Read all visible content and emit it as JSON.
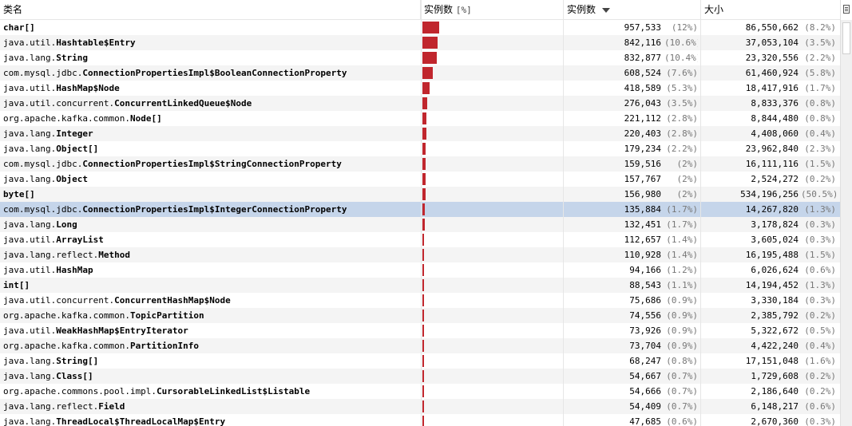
{
  "header": {
    "col_name": "类名",
    "col_bar": "实例数",
    "col_bar_sub": "[%]",
    "col_count": "实例数",
    "col_size": "大小"
  },
  "colors": {
    "bar": "#c0262d",
    "selected_row": "#c5d5ea"
  },
  "rows": [
    {
      "pkg": "",
      "cls": "char[]",
      "count": "957,533",
      "cpct": "(12%)",
      "size": "86,550,662",
      "spct": "(8.2%)",
      "bar_pct": 12.0
    },
    {
      "pkg": "java.util.",
      "cls": "Hashtable$Entry",
      "count": "842,116",
      "cpct": "(10.6%)",
      "size": "37,053,104",
      "spct": "(3.5%)",
      "bar_pct": 10.6
    },
    {
      "pkg": "java.lang.",
      "cls": "String",
      "count": "832,877",
      "cpct": "(10.4%)",
      "size": "23,320,556",
      "spct": "(2.2%)",
      "bar_pct": 10.4
    },
    {
      "pkg": "com.mysql.jdbc.",
      "cls": "ConnectionPropertiesImpl$BooleanConnectionProperty",
      "count": "608,524",
      "cpct": "(7.6%)",
      "size": "61,460,924",
      "spct": "(5.8%)",
      "bar_pct": 7.6
    },
    {
      "pkg": "java.util.",
      "cls": "HashMap$Node",
      "count": "418,589",
      "cpct": "(5.3%)",
      "size": "18,417,916",
      "spct": "(1.7%)",
      "bar_pct": 5.3
    },
    {
      "pkg": "java.util.concurrent.",
      "cls": "ConcurrentLinkedQueue$Node",
      "count": "276,043",
      "cpct": "(3.5%)",
      "size": "8,833,376",
      "spct": "(0.8%)",
      "bar_pct": 3.5
    },
    {
      "pkg": "org.apache.kafka.common.",
      "cls": "Node[]",
      "count": "221,112",
      "cpct": "(2.8%)",
      "size": "8,844,480",
      "spct": "(0.8%)",
      "bar_pct": 2.8
    },
    {
      "pkg": "java.lang.",
      "cls": "Integer",
      "count": "220,403",
      "cpct": "(2.8%)",
      "size": "4,408,060",
      "spct": "(0.4%)",
      "bar_pct": 2.8
    },
    {
      "pkg": "java.lang.",
      "cls": "Object[]",
      "count": "179,234",
      "cpct": "(2.2%)",
      "size": "23,962,840",
      "spct": "(2.3%)",
      "bar_pct": 2.2
    },
    {
      "pkg": "com.mysql.jdbc.",
      "cls": "ConnectionPropertiesImpl$StringConnectionProperty",
      "count": "159,516",
      "cpct": "(2%)",
      "size": "16,111,116",
      "spct": "(1.5%)",
      "bar_pct": 2.0
    },
    {
      "pkg": "java.lang.",
      "cls": "Object",
      "count": "157,767",
      "cpct": "(2%)",
      "size": "2,524,272",
      "spct": "(0.2%)",
      "bar_pct": 2.0
    },
    {
      "pkg": "",
      "cls": "byte[]",
      "count": "156,980",
      "cpct": "(2%)",
      "size": "534,196,256",
      "spct": "(50.5%)",
      "bar_pct": 2.0
    },
    {
      "pkg": "com.mysql.jdbc.",
      "cls": "ConnectionPropertiesImpl$IntegerConnectionProperty",
      "count": "135,884",
      "cpct": "(1.7%)",
      "size": "14,267,820",
      "spct": "(1.3%)",
      "bar_pct": 1.7,
      "selected": true
    },
    {
      "pkg": "java.lang.",
      "cls": "Long",
      "count": "132,451",
      "cpct": "(1.7%)",
      "size": "3,178,824",
      "spct": "(0.3%)",
      "bar_pct": 1.7
    },
    {
      "pkg": "java.util.",
      "cls": "ArrayList",
      "count": "112,657",
      "cpct": "(1.4%)",
      "size": "3,605,024",
      "spct": "(0.3%)",
      "bar_pct": 1.4
    },
    {
      "pkg": "java.lang.reflect.",
      "cls": "Method",
      "count": "110,928",
      "cpct": "(1.4%)",
      "size": "16,195,488",
      "spct": "(1.5%)",
      "bar_pct": 1.4
    },
    {
      "pkg": "java.util.",
      "cls": "HashMap",
      "count": "94,166",
      "cpct": "(1.2%)",
      "size": "6,026,624",
      "spct": "(0.6%)",
      "bar_pct": 1.2
    },
    {
      "pkg": "",
      "cls": "int[]",
      "count": "88,543",
      "cpct": "(1.1%)",
      "size": "14,194,452",
      "spct": "(1.3%)",
      "bar_pct": 1.1
    },
    {
      "pkg": "java.util.concurrent.",
      "cls": "ConcurrentHashMap$Node",
      "count": "75,686",
      "cpct": "(0.9%)",
      "size": "3,330,184",
      "spct": "(0.3%)",
      "bar_pct": 0.9
    },
    {
      "pkg": "org.apache.kafka.common.",
      "cls": "TopicPartition",
      "count": "74,556",
      "cpct": "(0.9%)",
      "size": "2,385,792",
      "spct": "(0.2%)",
      "bar_pct": 0.9
    },
    {
      "pkg": "java.util.",
      "cls": "WeakHashMap$EntryIterator",
      "count": "73,926",
      "cpct": "(0.9%)",
      "size": "5,322,672",
      "spct": "(0.5%)",
      "bar_pct": 0.9
    },
    {
      "pkg": "org.apache.kafka.common.",
      "cls": "PartitionInfo",
      "count": "73,704",
      "cpct": "(0.9%)",
      "size": "4,422,240",
      "spct": "(0.4%)",
      "bar_pct": 0.9
    },
    {
      "pkg": "java.lang.",
      "cls": "String[]",
      "count": "68,247",
      "cpct": "(0.8%)",
      "size": "17,151,048",
      "spct": "(1.6%)",
      "bar_pct": 0.8
    },
    {
      "pkg": "java.lang.",
      "cls": "Class[]",
      "count": "54,667",
      "cpct": "(0.7%)",
      "size": "1,729,608",
      "spct": "(0.2%)",
      "bar_pct": 0.7
    },
    {
      "pkg": "org.apache.commons.pool.impl.",
      "cls": "CursorableLinkedList$Listable",
      "count": "54,666",
      "cpct": "(0.7%)",
      "size": "2,186,640",
      "spct": "(0.2%)",
      "bar_pct": 0.7
    },
    {
      "pkg": "java.lang.reflect.",
      "cls": "Field",
      "count": "54,409",
      "cpct": "(0.7%)",
      "size": "6,148,217",
      "spct": "(0.6%)",
      "bar_pct": 0.7
    },
    {
      "pkg": "java.lang.",
      "cls": "ThreadLocal$ThreadLocalMap$Entry",
      "count": "47,685",
      "cpct": "(0.6%)",
      "size": "2,670,360",
      "spct": "(0.3%)",
      "bar_pct": 0.6
    }
  ]
}
